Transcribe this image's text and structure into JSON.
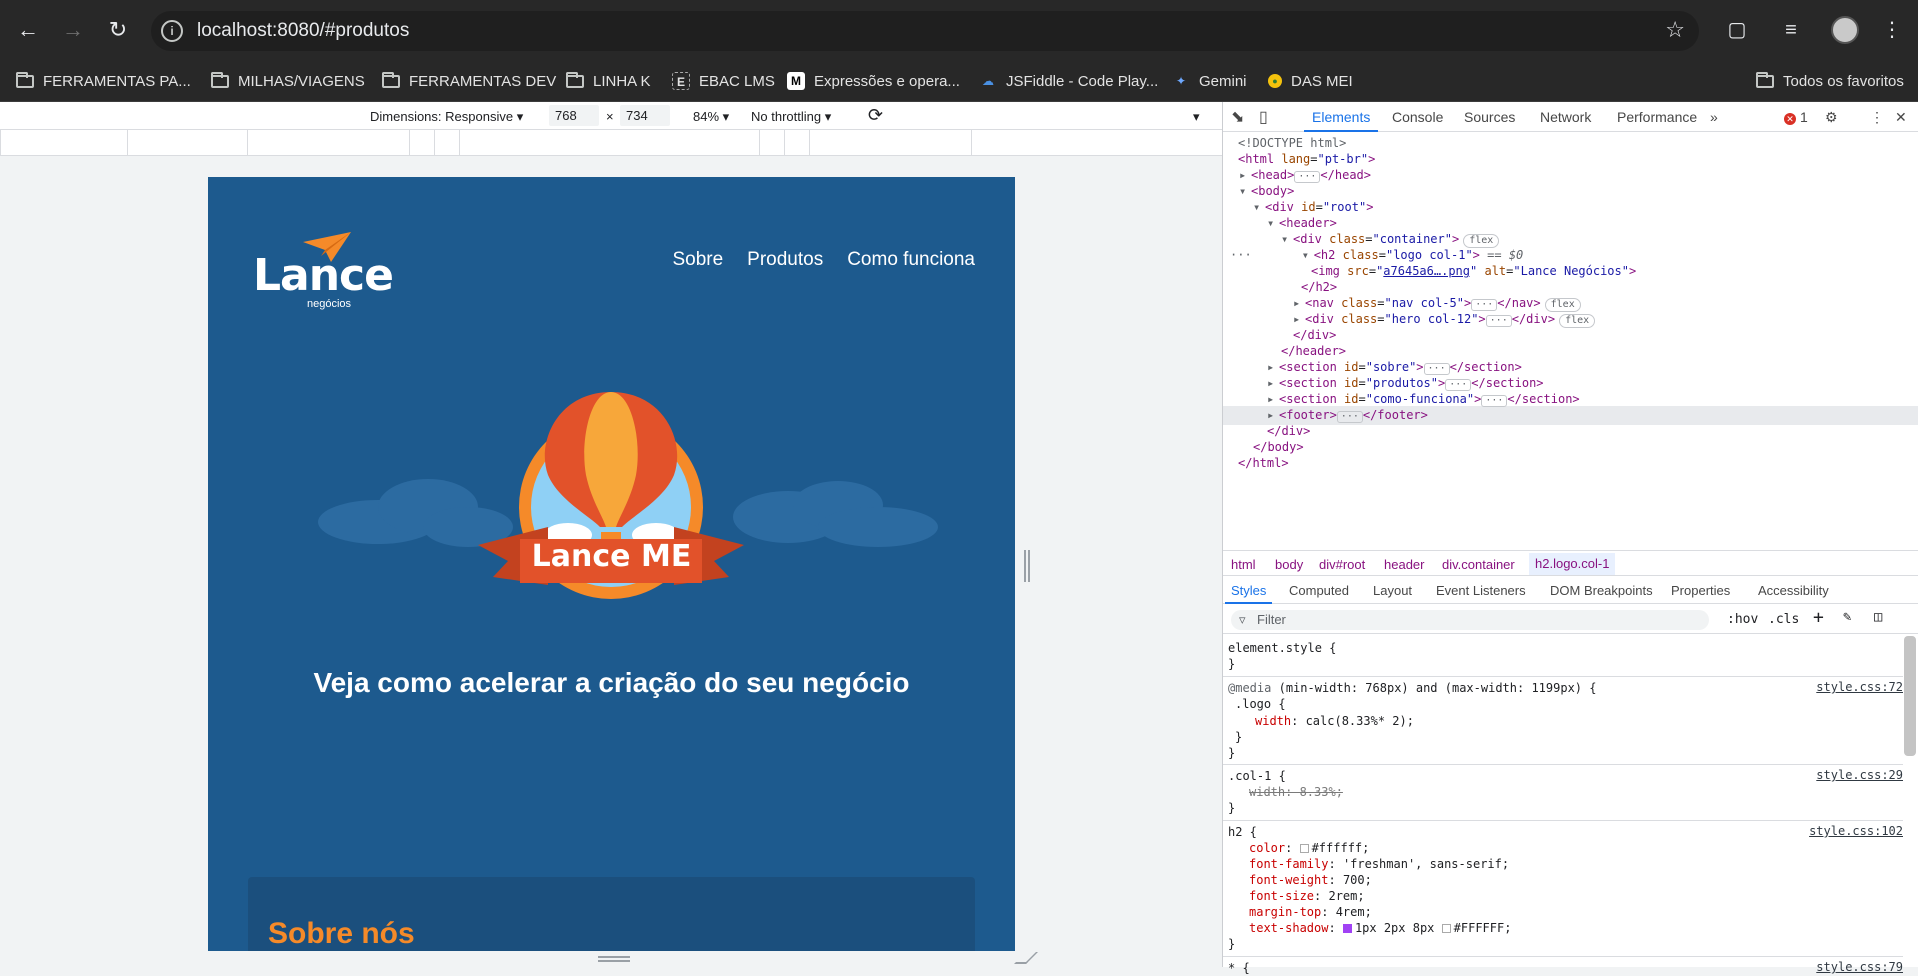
{
  "browser": {
    "url": "localhost:8080/#produtos",
    "bookmarks": [
      {
        "label": "FERRAMENTAS PA...",
        "icon": "folder-icon"
      },
      {
        "label": "MILHAS/VIAGENS",
        "icon": "folder-icon"
      },
      {
        "label": "FERRAMENTAS DEV",
        "icon": "folder-icon"
      },
      {
        "label": "LINHA K",
        "icon": "folder-icon"
      },
      {
        "label": "EBAC LMS",
        "icon": "ebac-icon"
      },
      {
        "label": "Expressões e opera...",
        "icon": "mdn-icon"
      },
      {
        "label": "JSFiddle - Code Play...",
        "icon": "jsfiddle-icon"
      },
      {
        "label": "Gemini",
        "icon": "gemini-icon"
      },
      {
        "label": "DAS MEI",
        "icon": "das-icon"
      }
    ],
    "all_bookmarks": "Todos os favoritos"
  },
  "device_toolbar": {
    "dimensions": "Dimensions: Responsive",
    "width": "768",
    "times": "×",
    "height": "734",
    "zoom": "84%",
    "throttling": "No throttling"
  },
  "site": {
    "logo_text": "Lance",
    "logo_sub": "negócios",
    "nav": [
      "Sobre",
      "Produtos",
      "Como funciona"
    ],
    "hero_badge": "Lance ME",
    "hero_title": "Veja como acelerar a criação do seu negócio",
    "section_title": "Sobre nós",
    "colors": {
      "bg": "#1d5a8e",
      "accent": "#f58a29"
    }
  },
  "devtools": {
    "tabs": [
      "Elements",
      "Console",
      "Sources",
      "Network",
      "Performance"
    ],
    "active_tab": "Elements",
    "error_count": "1",
    "breadcrumbs": [
      "html",
      "body",
      "div#root",
      "header",
      "div.container",
      "h2.logo.col-1"
    ],
    "sub_tabs": [
      "Styles",
      "Computed",
      "Layout",
      "Event Listeners",
      "DOM Breakpoints",
      "Properties",
      "Accessibility"
    ],
    "filter_placeholder": "Filter",
    "hov": ":hov",
    "cls": ".cls",
    "dom": {
      "doctype": "<!DOCTYPE html>",
      "html_open": "<html",
      "lang_attr": "lang",
      "lang_val": "\"pt-br\"",
      "head": "<head>",
      "head_close": "</head>",
      "body": "<body>",
      "div_root": "<div",
      "id_attr": "id",
      "root_val": "\"root\"",
      "header": "<header>",
      "container_val": "\"container\"",
      "h2_val": "\"logo col-1\"",
      "eq0": "== $0",
      "img_src": "a7645a6….png",
      "img_alt": "\"Lance Negócios\"",
      "nav_val": "\"nav col-5\"",
      "hero_val": "\"hero col-12\"",
      "sobre_val": "\"sobre\"",
      "produtos_val": "\"produtos\"",
      "como_val": "\"como-funciona\"",
      "footer": "<footer>",
      "flex": "flex"
    },
    "styles": {
      "element_style": "element.style {",
      "media": "@media",
      "media_query": "(min-width: 768px) and (max-width: 1199px) {",
      "media_src": "style.css:72",
      "logo_sel": ".logo {",
      "logo_width_prop": "width",
      "logo_width_val": "calc(8.33%* 2);",
      "col1_sel": ".col-1 {",
      "col1_src": "style.css:29",
      "col1_prop": "width: 8.33%;",
      "h2_sel": "h2 {",
      "h2_src": "style.css:102",
      "color_prop": "color",
      "color_val": "#ffffff;",
      "ff_prop": "font-family",
      "ff_val": "'freshman', sans-serif;",
      "fw_prop": "font-weight",
      "fw_val": "700;",
      "fs_prop": "font-size",
      "fs_val": "2rem;",
      "mt_prop": "margin-top",
      "mt_val": "4rem;",
      "ts_prop": "text-shadow",
      "ts_val": "1px 2px 8px",
      "ts_color": "#FFFFFF;",
      "star_sel": "* {",
      "star_src": "style.css:79"
    }
  }
}
